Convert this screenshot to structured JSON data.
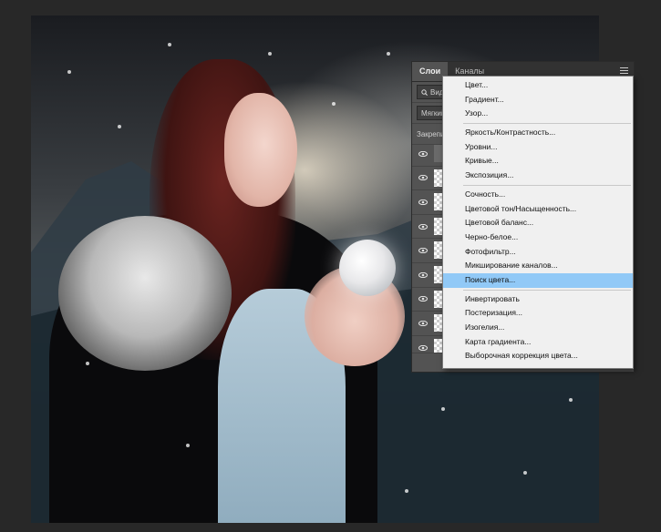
{
  "panel": {
    "tabs": [
      {
        "label": "Слои",
        "active": true
      },
      {
        "label": "Каналы",
        "active": false
      }
    ],
    "filter_label": "Вид",
    "blend_mode": "Мягкий",
    "lock_label": "Закрепить",
    "layer_count": 9
  },
  "adjustment_menu": {
    "groups": [
      [
        "Цвет...",
        "Градиент...",
        "Узор..."
      ],
      [
        "Яркость/Контрастность...",
        "Уровни...",
        "Кривые...",
        "Экспозиция..."
      ],
      [
        "Сочность...",
        "Цветовой тон/Насыщенность...",
        "Цветовой баланс...",
        "Черно-белое...",
        "Фотофильтр...",
        "Микширование каналов...",
        "Поиск цвета..."
      ],
      [
        "Инвертировать",
        "Постеризация...",
        "Изогелия...",
        "Карта градиента...",
        "Выборочная коррекция цвета..."
      ]
    ],
    "highlighted": "Поиск цвета..."
  },
  "colors": {
    "highlight": "#91c9f7",
    "panel_bg": "#535353",
    "workspace_bg": "#282828"
  }
}
